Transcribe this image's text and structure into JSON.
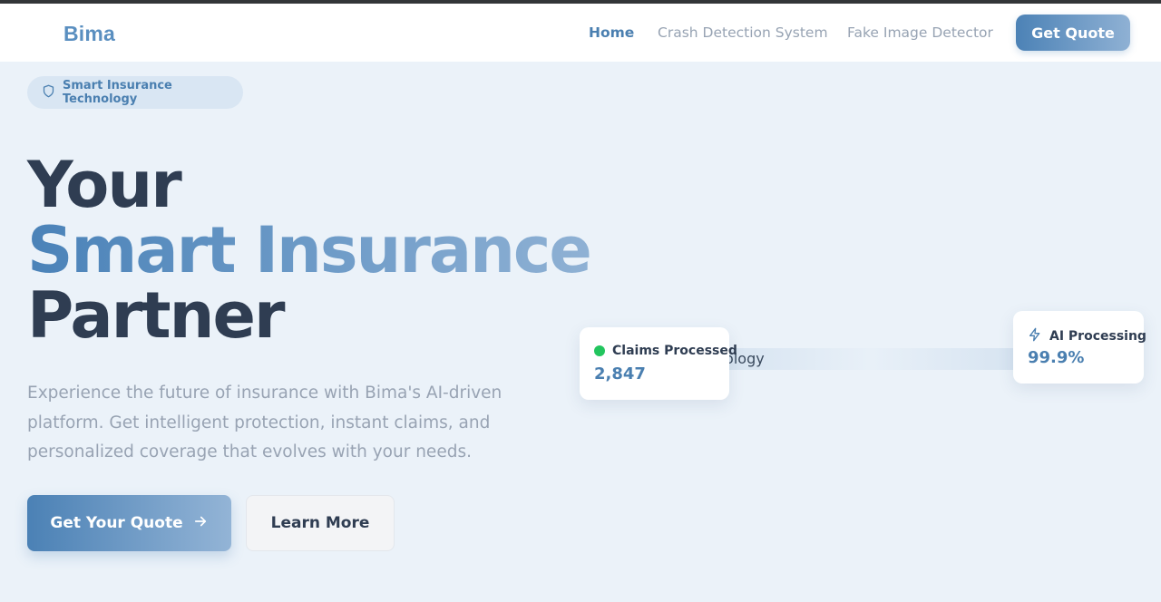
{
  "nav": {
    "logo": "Bima",
    "links": [
      {
        "label": "Home",
        "active": true
      },
      {
        "label": "Crash Detection System",
        "active": false
      },
      {
        "label": "Fake Image Detector",
        "active": false
      }
    ],
    "cta_label": "Get Quote"
  },
  "hero": {
    "badge": "Smart Insurance Technology",
    "title_line1": "Your",
    "title_line2": "Smart Insurance",
    "title_line3": "Partner",
    "description": "Experience the future of insurance with Bima's AI-driven platform. Get intelligent protection, instant claims, and personalized coverage that evolves with your needs.",
    "primary_button": "Get Your Quote",
    "secondary_button": "Learn More"
  },
  "visual": {
    "band_text": "Smart Insurance Technology",
    "cards": [
      {
        "title": "Claims Processed",
        "value": "2,847",
        "icon": "green-dot"
      },
      {
        "title": "AI Processing",
        "value": "99.9%",
        "icon": "lightning-icon"
      }
    ]
  },
  "colors": {
    "accent": "#4a7fb0",
    "background": "#ebf2f9",
    "heading": "#2f3d52",
    "muted": "#98a3b3",
    "status_green": "#22c55e"
  }
}
